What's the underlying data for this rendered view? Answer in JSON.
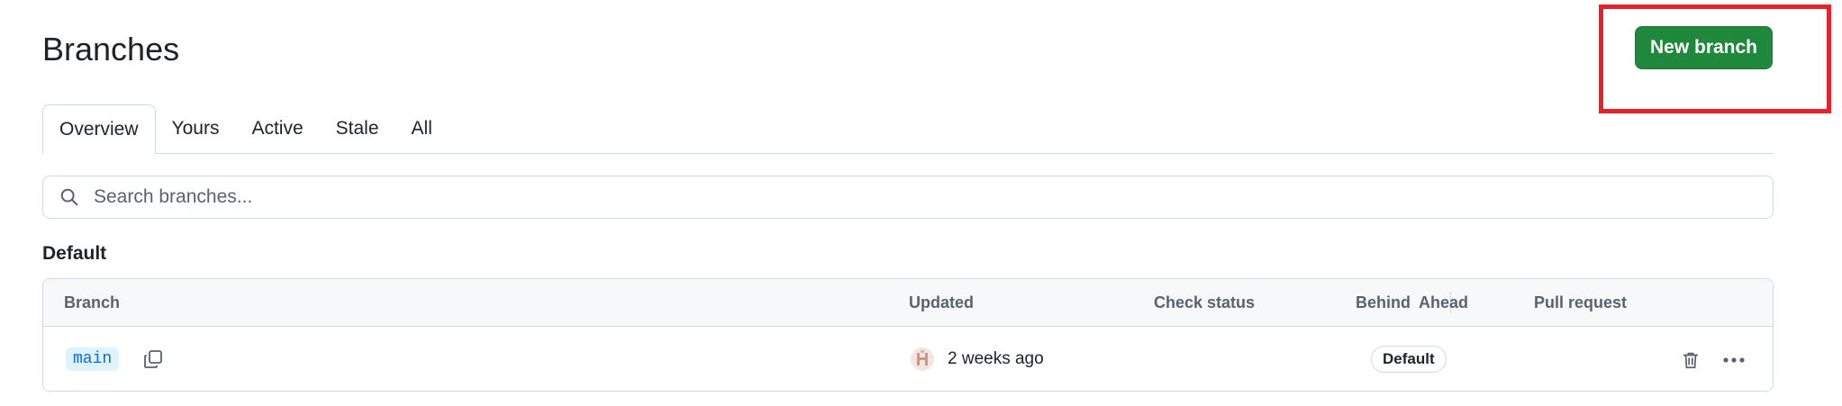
{
  "header": {
    "title": "Branches",
    "new_branch_label": "New branch"
  },
  "tabs": [
    {
      "label": "Overview",
      "selected": true
    },
    {
      "label": "Yours",
      "selected": false
    },
    {
      "label": "Active",
      "selected": false
    },
    {
      "label": "Stale",
      "selected": false
    },
    {
      "label": "All",
      "selected": false
    }
  ],
  "search": {
    "placeholder": "Search branches...",
    "value": "",
    "icon": "search-icon"
  },
  "section": {
    "title": "Default"
  },
  "table": {
    "columns": {
      "branch": "Branch",
      "updated": "Updated",
      "check_status": "Check status",
      "behind": "Behind",
      "ahead": "Ahead",
      "pull_request": "Pull request"
    },
    "rows": [
      {
        "branch": "main",
        "updated": "2 weeks ago",
        "badge": "Default",
        "icons": [
          "copy-icon",
          "avatar",
          "trash-icon",
          "kebab-icon"
        ]
      }
    ]
  },
  "colors": {
    "primary_button": "#1f883d",
    "highlight": "#e3222c",
    "branch_chip_bg": "#ddf4ff",
    "branch_chip_text": "#0969da",
    "border": "#d1d9e0",
    "header_bg": "#f6f8fa"
  }
}
